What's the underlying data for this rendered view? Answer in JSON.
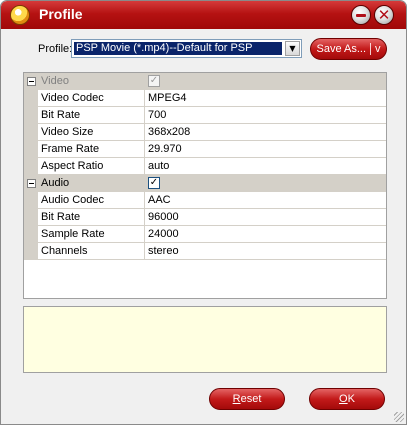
{
  "window": {
    "title": "Profile",
    "icons": {
      "app": "app-logo-icon",
      "minimize": "minimize-icon",
      "close": "close-icon"
    }
  },
  "profile": {
    "label": "Profile:",
    "selected": "PSP Movie (*.mp4)--Default for PSP",
    "save_as_label": "Save As...",
    "save_as_arrow": "v"
  },
  "properties": {
    "video": {
      "category": "Video",
      "enabled_checked": "✓",
      "rows": [
        {
          "name": "Video Codec",
          "value": "MPEG4"
        },
        {
          "name": "Bit Rate",
          "value": "700"
        },
        {
          "name": "Video Size",
          "value": "368x208"
        },
        {
          "name": "Frame Rate",
          "value": "29.970"
        },
        {
          "name": "Aspect Ratio",
          "value": "auto"
        }
      ]
    },
    "audio": {
      "category": "Audio",
      "enabled_checked": "✓",
      "rows": [
        {
          "name": "Audio Codec",
          "value": "AAC"
        },
        {
          "name": "Bit Rate",
          "value": "96000"
        },
        {
          "name": "Sample Rate",
          "value": "24000"
        },
        {
          "name": "Channels",
          "value": "stereo"
        }
      ]
    }
  },
  "buttons": {
    "reset_first": "R",
    "reset_rest": "eset",
    "ok_first": "O",
    "ok_rest": "K"
  },
  "colors": {
    "titlebar": "#b51212",
    "selection": "#0a246a",
    "description_bg": "#ffffe1"
  }
}
